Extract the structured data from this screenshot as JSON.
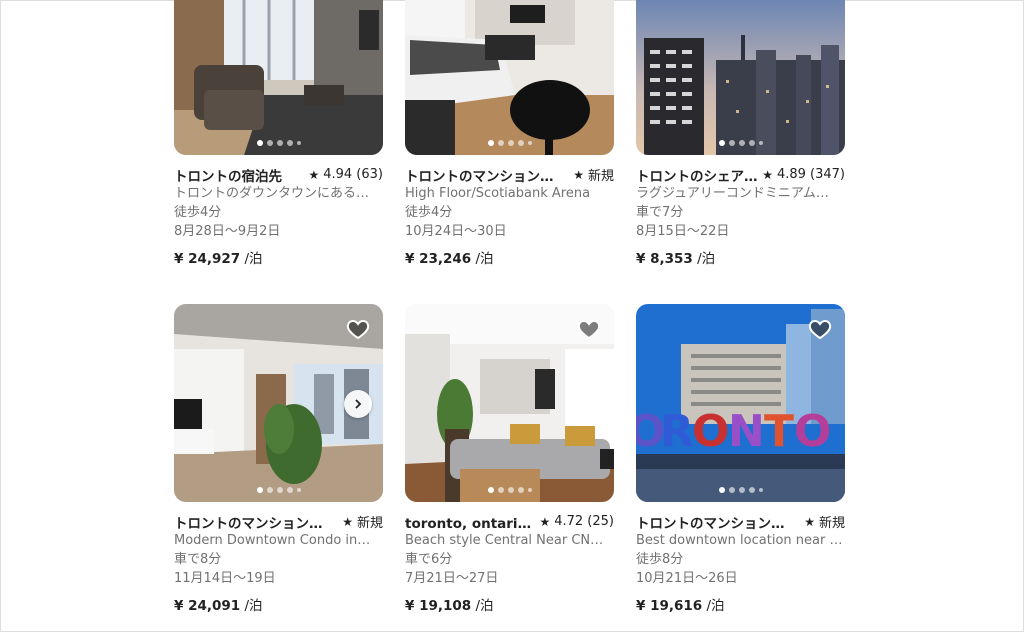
{
  "listings": [
    {
      "title": "トロントの宿泊先",
      "rating": "4.94 (63)",
      "subtitle": "トロントのダウンタウンにある…",
      "distance": "徒歩4分",
      "dates": "8月28日〜9月2日",
      "price": "¥ 24,927",
      "per": "/泊"
    },
    {
      "title": "トロントのマンション…",
      "rating": "新規",
      "subtitle": "High Floor/Scotiabank Arena",
      "distance": "徒歩4分",
      "dates": "10月24日〜30日",
      "price": "¥ 23,246",
      "per": "/泊"
    },
    {
      "title": "トロントのシェア…",
      "rating": "4.89 (347)",
      "subtitle": "ラグジュアリーコンドミニアム…",
      "distance": "車で7分",
      "dates": "8月15日〜22日",
      "price": "¥ 8,353",
      "per": "/泊"
    },
    {
      "title": "トロントのマンション…",
      "rating": "新規",
      "subtitle": "Modern Downtown Condo in…",
      "distance": "車で8分",
      "dates": "11月14日〜19日",
      "price": "¥ 24,091",
      "per": "/泊"
    },
    {
      "title": "toronto, ontario,の…",
      "rating": "4.72 (25)",
      "subtitle": "Beach style Central Near CN…",
      "distance": "車で6分",
      "dates": "7月21日〜27日",
      "price": "¥ 19,108",
      "per": "/泊"
    },
    {
      "title": "トロントのマンション…",
      "rating": "新規",
      "subtitle": "Best downtown location near C…",
      "distance": "徒歩8分",
      "dates": "10月21日〜26日",
      "price": "¥ 19,616",
      "per": "/泊"
    }
  ],
  "icons": {
    "star": "star-icon",
    "heart": "heart-outline-icon",
    "next": "chevron-right-icon"
  },
  "colors": {
    "text": "#222222",
    "secondary": "#717171"
  }
}
